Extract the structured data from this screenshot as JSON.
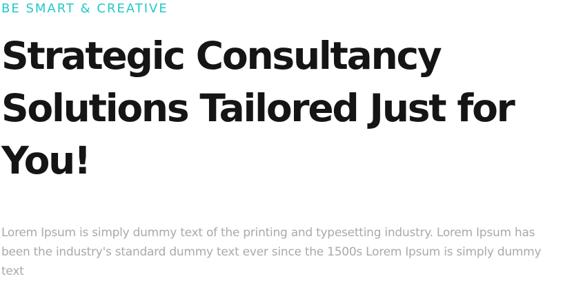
{
  "hero": {
    "eyebrow": "BE SMART & CREATIVE",
    "headline": "Strategic Consultancy Solutions Tailored Just for You!",
    "description": "Lorem Ipsum is simply dummy text of the printing and typesetting industry. Lorem Ipsum has been the industry's standard dummy text ever since the 1500s Lorem Ipsum is simply dummy text"
  },
  "colors": {
    "accent": "#20c9c9",
    "heading": "#151515",
    "body_text": "#a9a9a9",
    "background": "#ffffff"
  }
}
